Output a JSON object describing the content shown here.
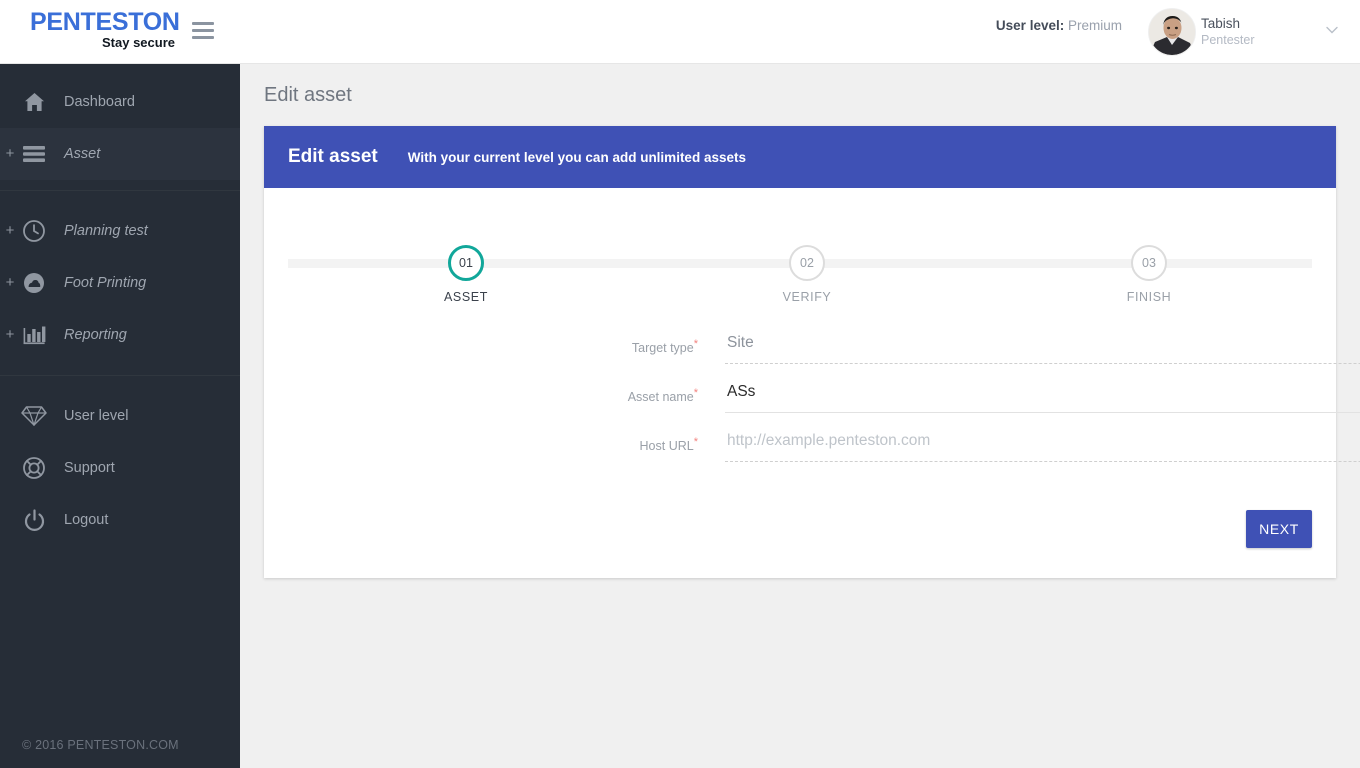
{
  "brand": {
    "logo_main": "PENTESTON",
    "logo_sub": "Stay secure",
    "accent_blue": "#3a6fd8"
  },
  "topbar": {
    "menu_icon": "hamburger-icon",
    "user_level_label": "User level:",
    "user_level_value": "Premium",
    "user_name": "Tabish",
    "user_role": "Pentester",
    "caret_icon": "chevron-down-icon"
  },
  "sidebar": {
    "groups": [
      {
        "items": [
          {
            "label": "Dashboard",
            "icon": "home-icon",
            "expandable": false,
            "italic": false,
            "active": false
          },
          {
            "label": "Asset",
            "icon": "list-icon",
            "expandable": true,
            "expand_glyph": "+",
            "italic": true,
            "active": true
          }
        ]
      },
      {
        "items": [
          {
            "label": "Planning test",
            "icon": "clock-icon",
            "expandable": true,
            "expand_glyph": "+",
            "italic": true,
            "active": false
          },
          {
            "label": "Foot Printing",
            "icon": "cloud-icon",
            "expandable": true,
            "expand_glyph": "+",
            "italic": true,
            "active": false
          },
          {
            "label": "Reporting",
            "icon": "bar-chart-icon",
            "expandable": true,
            "expand_glyph": "+",
            "italic": true,
            "active": false
          }
        ]
      },
      {
        "items": [
          {
            "label": "User level",
            "icon": "diamond-icon",
            "expandable": false,
            "italic": false,
            "active": false
          },
          {
            "label": "Support",
            "icon": "lifebuoy-icon",
            "expandable": false,
            "italic": false,
            "active": false
          },
          {
            "label": "Logout",
            "icon": "power-icon",
            "expandable": false,
            "italic": false,
            "active": false
          }
        ]
      }
    ],
    "footer": "© 2016 PENTESTON.COM"
  },
  "main": {
    "page_title": "Edit asset",
    "card": {
      "title": "Edit asset",
      "subtitle": "With your current level you can add unlimited assets",
      "header_color": "#3f51b5"
    },
    "stepper": {
      "active_color": "#11a79a",
      "steps": [
        {
          "number": "01",
          "caption": "ASSET",
          "state": "active"
        },
        {
          "number": "02",
          "caption": "VERIFY",
          "state": "idle"
        },
        {
          "number": "03",
          "caption": "FINISH",
          "state": "idle"
        }
      ]
    },
    "form": {
      "fields": [
        {
          "label": "Target type",
          "required_glyph": "*",
          "kind": "select",
          "value": "Site",
          "placeholder": "",
          "caret_icon": "dropdown-caret-icon"
        },
        {
          "label": "Asset name",
          "required_glyph": "*",
          "kind": "text",
          "value": "ASs",
          "placeholder": ""
        },
        {
          "label": "Host URL",
          "required_glyph": "*",
          "kind": "text",
          "value": "",
          "placeholder": "http://example.penteston.com"
        }
      ],
      "submit_label": "NEXT"
    }
  }
}
